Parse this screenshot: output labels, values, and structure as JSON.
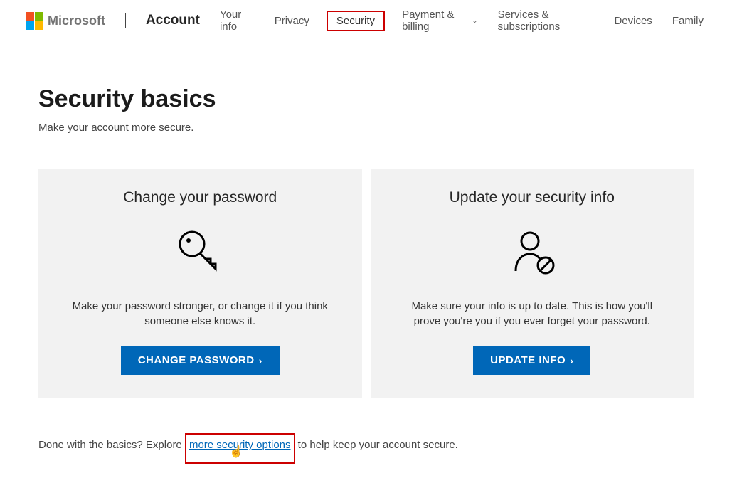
{
  "header": {
    "brand": "Microsoft",
    "account_label": "Account",
    "nav": {
      "your_info": "Your info",
      "privacy": "Privacy",
      "security": "Security",
      "payment": "Payment & billing",
      "services": "Services & subscriptions",
      "devices": "Devices",
      "family": "Family"
    }
  },
  "page": {
    "title": "Security basics",
    "subtitle": "Make your account more secure."
  },
  "cards": {
    "password": {
      "title": "Change your password",
      "desc": "Make your password stronger, or change it if you think someone else knows it.",
      "button": "CHANGE PASSWORD"
    },
    "info": {
      "title": "Update your security info",
      "desc": "Make sure your info is up to date. This is how you'll prove you're you if you ever forget your password.",
      "button": "UPDATE INFO"
    }
  },
  "footer": {
    "prefix": "Done with the basics? Explore ",
    "link": "more security options",
    "suffix": " to help keep your account secure."
  }
}
